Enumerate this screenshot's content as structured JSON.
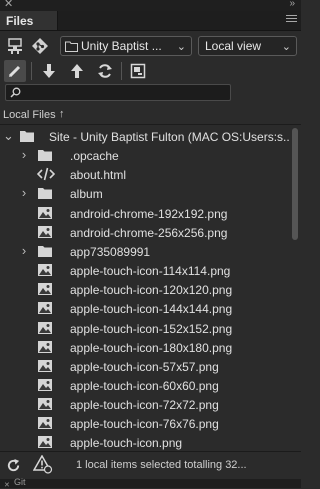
{
  "panel": {
    "tab_label": "Files",
    "site_select": "Unity Baptist ...",
    "view_select": "Local view",
    "search_placeholder": "",
    "column_header": "Local Files",
    "sort_arrow": "↑"
  },
  "tree": {
    "root_label": "Site - Unity Baptist Fulton (MAC OS:Users:s...",
    "items": [
      {
        "label": ".opcache",
        "icon": "folder-icon",
        "expandable": true
      },
      {
        "label": "about.html",
        "icon": "code-file-icon",
        "expandable": false
      },
      {
        "label": "album",
        "icon": "folder-icon",
        "expandable": true
      },
      {
        "label": "android-chrome-192x192.png",
        "icon": "image-file-icon",
        "expandable": false
      },
      {
        "label": "android-chrome-256x256.png",
        "icon": "image-file-icon",
        "expandable": false
      },
      {
        "label": "app735089991",
        "icon": "folder-icon",
        "expandable": true
      },
      {
        "label": "apple-touch-icon-114x114.png",
        "icon": "image-file-icon",
        "expandable": false
      },
      {
        "label": "apple-touch-icon-120x120.png",
        "icon": "image-file-icon",
        "expandable": false
      },
      {
        "label": "apple-touch-icon-144x144.png",
        "icon": "image-file-icon",
        "expandable": false
      },
      {
        "label": "apple-touch-icon-152x152.png",
        "icon": "image-file-icon",
        "expandable": false
      },
      {
        "label": "apple-touch-icon-180x180.png",
        "icon": "image-file-icon",
        "expandable": false
      },
      {
        "label": "apple-touch-icon-57x57.png",
        "icon": "image-file-icon",
        "expandable": false
      },
      {
        "label": "apple-touch-icon-60x60.png",
        "icon": "image-file-icon",
        "expandable": false
      },
      {
        "label": "apple-touch-icon-72x72.png",
        "icon": "image-file-icon",
        "expandable": false
      },
      {
        "label": "apple-touch-icon-76x76.png",
        "icon": "image-file-icon",
        "expandable": false
      },
      {
        "label": "apple-touch-icon.png",
        "icon": "image-file-icon",
        "expandable": false
      }
    ]
  },
  "status": {
    "message": "1 local items selected totalling 32..."
  },
  "bottom_panel": {
    "tab_label": "Git"
  }
}
